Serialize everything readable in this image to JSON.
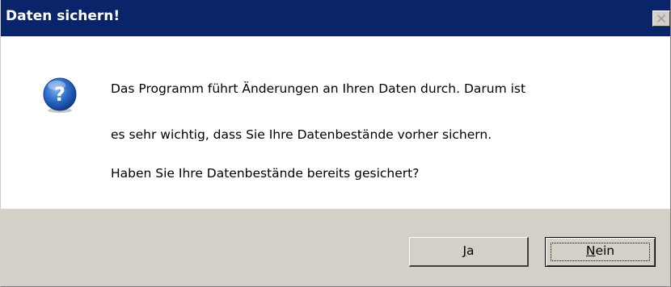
{
  "window": {
    "title": "Daten sichern!",
    "close_icon": "close-icon"
  },
  "message": {
    "icon": "question-icon",
    "line1": "Das Programm führt Änderungen an Ihren Daten durch. Darum ist",
    "line2": "es sehr wichtig, dass Sie Ihre Datenbestände vorher sichern.",
    "line3": "Haben Sie Ihre Datenbestände bereits gesichert?"
  },
  "buttons": {
    "yes_mnemonic": "J",
    "yes_rest": "a",
    "no_mnemonic": "N",
    "no_rest": "ein"
  },
  "colors": {
    "titlebar": "#0a246a",
    "face": "#d4d0c8",
    "content_bg": "#ffffff",
    "icon_blue": "#1f5fb8"
  }
}
